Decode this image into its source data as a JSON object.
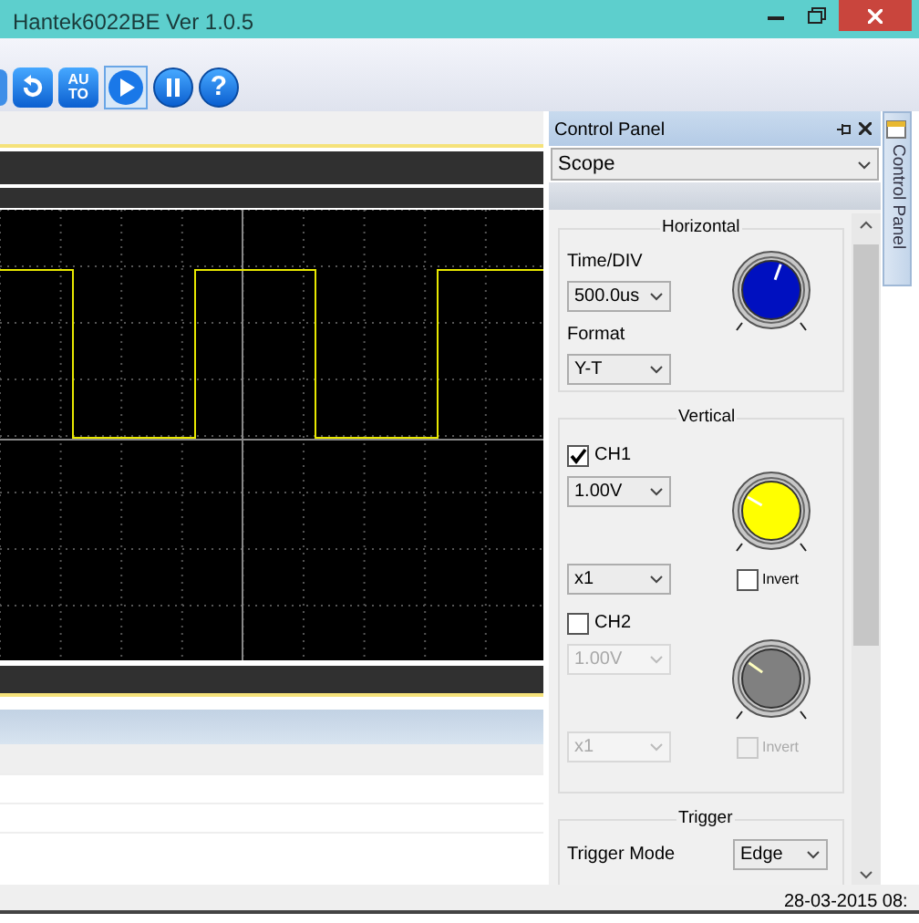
{
  "window": {
    "title": "Hantek6022BE Ver 1.0.5"
  },
  "toolbar": {
    "buttons": [
      {
        "kind": "partial"
      },
      {
        "kind": "rotate"
      },
      {
        "kind": "auto",
        "label": "AU TO"
      },
      {
        "kind": "play",
        "selected": true
      },
      {
        "kind": "pause"
      },
      {
        "kind": "help",
        "label": "?"
      }
    ]
  },
  "control_panel": {
    "title": "Control Panel",
    "mode": "Scope",
    "side_tab": "Control Panel",
    "horizontal": {
      "title": "Horizontal",
      "time_label": "Time/DIV",
      "time_value": "500.0us",
      "format_label": "Format",
      "format_value": "Y-T",
      "color": "#0010c0"
    },
    "vertical": {
      "title": "Vertical"
    },
    "channels": [
      {
        "name": "CH1",
        "checked": true,
        "volts": "1.00V",
        "probe": "x1",
        "invert_label": "Invert",
        "inverted": false,
        "color": "#ffff00"
      },
      {
        "name": "CH2",
        "checked": false,
        "volts": "1.00V",
        "probe": "x1",
        "invert_label": "Invert",
        "inverted": false,
        "color": "#808080"
      }
    ],
    "trigger": {
      "title": "Trigger",
      "mode_label": "Trigger Mode",
      "mode_value": "Edge"
    }
  },
  "status_bar": {
    "datetime": "28-03-2015 08:"
  }
}
